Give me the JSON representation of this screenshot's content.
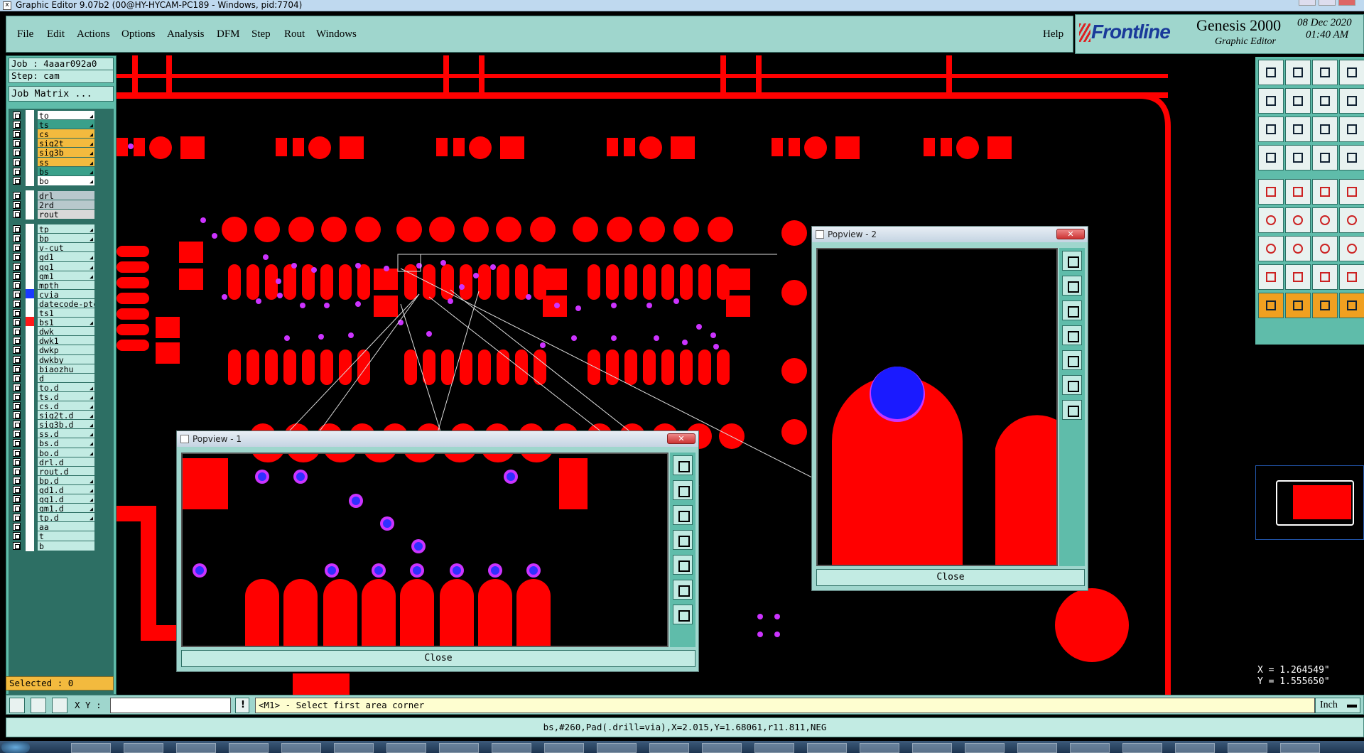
{
  "window": {
    "title": "Graphic Editor 9.07b2 (00@HY-HYCAM-PC189 - Windows, pid:7704)",
    "icon": "x-icon"
  },
  "menu": {
    "items": [
      "File",
      "Edit",
      "Actions",
      "Options",
      "Analysis",
      "DFM",
      "Step",
      "Rout",
      "Windows"
    ],
    "help": "Help"
  },
  "brand": {
    "logo": "Frontline",
    "product": "Genesis 2000",
    "subtitle": "Graphic Editor",
    "date": "08 Dec 2020",
    "time": "01:40 AM"
  },
  "job": {
    "job_label": "Job : 4aaar092a0",
    "step_label": "Step: cam",
    "matrix_button": "Job Matrix ..."
  },
  "layers": [
    {
      "name": "to",
      "color": "#ffffff",
      "mark": true
    },
    {
      "name": "ts",
      "color": "#3aa08a",
      "mark": true
    },
    {
      "name": "cs",
      "color": "#f3ba3e",
      "mark": true
    },
    {
      "name": "sig2t",
      "color": "#f3ba3e",
      "mark": true
    },
    {
      "name": "sig3b",
      "color": "#f3ba3e",
      "mark": true
    },
    {
      "name": "ss",
      "color": "#f3ba3e",
      "mark": true
    },
    {
      "name": "bs",
      "color": "#3aa08a",
      "mark": true
    },
    {
      "name": "bo",
      "color": "#ffffff",
      "mark": true
    },
    {
      "name": "drl",
      "color": "#b8c8cc",
      "mark": false
    },
    {
      "name": "2rd",
      "color": "#b8c8cc",
      "mark": false
    },
    {
      "name": "rout",
      "color": "#d8d8d8",
      "mark": false
    },
    {
      "name": "tp",
      "color": "#c2ebe3",
      "mark": true
    },
    {
      "name": "bp",
      "color": "#c2ebe3",
      "mark": true
    },
    {
      "name": "v-cut",
      "color": "#c2ebe3",
      "mark": false
    },
    {
      "name": "gd1",
      "color": "#c2ebe3",
      "mark": true
    },
    {
      "name": "gg1",
      "color": "#c2ebe3",
      "mark": true
    },
    {
      "name": "gm1",
      "color": "#c2ebe3",
      "mark": true
    },
    {
      "name": "mpth",
      "color": "#c2ebe3",
      "mark": false
    },
    {
      "name": "cvia",
      "color": "#c2ebe3",
      "mark": false,
      "swatch": "#1a3aff"
    },
    {
      "name": "datecode-ptc",
      "color": "#c2ebe3",
      "mark": false
    },
    {
      "name": "ts1",
      "color": "#c2ebe3",
      "mark": false
    },
    {
      "name": "bs1",
      "color": "#c2ebe3",
      "mark": true,
      "swatch": "#ff1a1a"
    },
    {
      "name": "dwk",
      "color": "#c2ebe3",
      "mark": false
    },
    {
      "name": "dwk1",
      "color": "#c2ebe3",
      "mark": false
    },
    {
      "name": "dwkp",
      "color": "#c2ebe3",
      "mark": false
    },
    {
      "name": "dwkby",
      "color": "#c2ebe3",
      "mark": false
    },
    {
      "name": "biaozhu",
      "color": "#c2ebe3",
      "mark": false
    },
    {
      "name": "d",
      "color": "#c2ebe3",
      "mark": false
    },
    {
      "name": "to.d",
      "color": "#c2ebe3",
      "mark": true
    },
    {
      "name": "ts.d",
      "color": "#c2ebe3",
      "mark": true
    },
    {
      "name": "cs.d",
      "color": "#c2ebe3",
      "mark": true
    },
    {
      "name": "sig2t.d",
      "color": "#c2ebe3",
      "mark": true
    },
    {
      "name": "sig3b.d",
      "color": "#c2ebe3",
      "mark": true
    },
    {
      "name": "ss.d",
      "color": "#c2ebe3",
      "mark": true
    },
    {
      "name": "bs.d",
      "color": "#c2ebe3",
      "mark": true
    },
    {
      "name": "bo.d",
      "color": "#c2ebe3",
      "mark": true
    },
    {
      "name": "drl.d",
      "color": "#c2ebe3",
      "mark": false
    },
    {
      "name": "rout.d",
      "color": "#c2ebe3",
      "mark": false
    },
    {
      "name": "bp.d",
      "color": "#c2ebe3",
      "mark": true
    },
    {
      "name": "gd1.d",
      "color": "#c2ebe3",
      "mark": true
    },
    {
      "name": "gg1.d",
      "color": "#c2ebe3",
      "mark": true
    },
    {
      "name": "gm1.d",
      "color": "#c2ebe3",
      "mark": true
    },
    {
      "name": "tp.d",
      "color": "#c2ebe3",
      "mark": true
    },
    {
      "name": "aa",
      "color": "#c2ebe3",
      "mark": false
    },
    {
      "name": "t",
      "color": "#c2ebe3",
      "mark": false
    },
    {
      "name": "b",
      "color": "#c2ebe3",
      "mark": false
    }
  ],
  "selected": "Selected : 0",
  "popview1": {
    "title": "Popview - 1",
    "close": "Close"
  },
  "popview2": {
    "title": "Popview - 2",
    "close": "Close"
  },
  "coords": {
    "x": "X = 1.264549\"",
    "y": "Y = 1.555650\""
  },
  "command": {
    "xy_label": "X Y :",
    "xy_value": "",
    "prompt": "<M1> - Select first area corner",
    "units": "Inch"
  },
  "status": "bs,#260,Pad(.drill=via),X=2.015,Y=1.68061,r11.811,NEG",
  "colors": {
    "copper": "#ff0000",
    "via": "#cc33ff",
    "hole": "#1a1aff",
    "panel": "#5fbcaa",
    "menu": "#9fd6cd"
  },
  "tool_icons": [
    "zoom-home-icon",
    "zoom-in-icon",
    "zoom-out-icon",
    "zoom-fit-icon",
    "pan-left-icon",
    "pan-right-icon",
    "ratio-icon",
    "measure-icon",
    "select-icon",
    "snap-icon",
    "grid-icon",
    "highlight-icon",
    "feature-icon",
    "move-icon",
    "copy-icon",
    "delete-icon",
    "line-icon",
    "arc-icon",
    "pad-icon",
    "text-icon",
    "triangle-icon",
    "polygon-icon",
    "cursor-icon",
    "pointer-icon",
    "rotate-icon",
    "route-icon"
  ]
}
